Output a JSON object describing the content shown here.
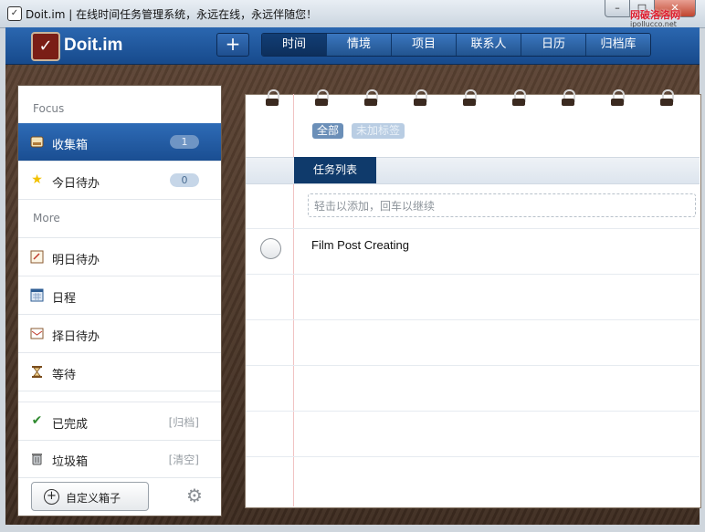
{
  "window": {
    "title": "Doit.im | 在线时间任务管理系统，永远在线，永远伴随您！",
    "minimize": "–",
    "maximize": "□",
    "close": "✕",
    "watermark": "网破洛洛网",
    "watermark_sub": "ipollucco.net"
  },
  "header": {
    "logo_text": "Doit.im",
    "add_button": "+",
    "tabs": [
      "时间",
      "情境",
      "项目",
      "联系人",
      "日历",
      "归档库"
    ],
    "active_tab": "时间"
  },
  "sidebar": {
    "focus_label": "Focus",
    "more_label": "More",
    "items": [
      {
        "label": "收集箱",
        "badge": "1",
        "icon": "inbox-icon"
      },
      {
        "label": "今日待办",
        "badge": "0",
        "icon": "star-icon"
      },
      {
        "label": "明日待办",
        "icon": "note-icon"
      },
      {
        "label": "日程",
        "icon": "calendar-icon"
      },
      {
        "label": "择日待办",
        "icon": "envelope-icon"
      },
      {
        "label": "等待",
        "icon": "hourglass-icon"
      },
      {
        "label": "已完成",
        "action": "[归档]",
        "icon": "check-icon"
      },
      {
        "label": "垃圾箱",
        "action": "[清空]",
        "icon": "trash-icon"
      }
    ],
    "custom_box_button": "自定义箱子",
    "settings_icon": "gear-icon"
  },
  "main": {
    "filters": [
      "全部",
      "未加标签"
    ],
    "list_header": "任务列表",
    "add_placeholder": "轻击以添加，回车以继续",
    "tasks": [
      {
        "title": "Film Post Creating",
        "done": false
      }
    ]
  },
  "colors": {
    "accent": "#1a4e92",
    "header_bg": "#174a8c",
    "active_tab": "#0d2f5c",
    "badge": "#c6d6e8"
  }
}
